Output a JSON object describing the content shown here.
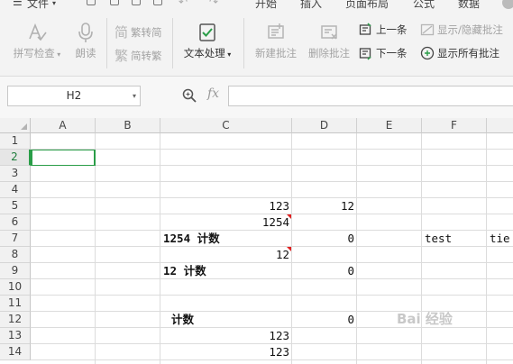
{
  "menubar": {
    "file_label": "文件",
    "tabs": [
      "开始",
      "插入",
      "页面布局",
      "公式",
      "数据"
    ]
  },
  "ribbon": {
    "spellcheck": "拼写检查",
    "read_aloud": "朗读",
    "trad_to_simp": "繁转简",
    "simp_to_trad": "简转繁",
    "text_processing": "文本处理",
    "new_comment": "新建批注",
    "delete_comment": "删除批注",
    "prev_comment": "上一条",
    "next_comment": "下一条",
    "toggle_comments": "显示/隐藏批注",
    "show_all_comments": "显示所有批注"
  },
  "formula_bar": {
    "name_box": "H2",
    "fx_label": "fx",
    "formula": ""
  },
  "grid": {
    "columns": [
      "A",
      "B",
      "C",
      "D",
      "E",
      "F"
    ],
    "rows": [
      "1",
      "2",
      "3",
      "4",
      "5",
      "6",
      "7",
      "8",
      "9",
      "10",
      "11",
      "12",
      "13",
      "14"
    ],
    "selected_row": "2",
    "cells": {
      "C5": "123",
      "D5": "12",
      "C6": "1254",
      "C7": "1254 计数",
      "D7": "0",
      "F7": "test",
      "G7": "tie",
      "C8": "12",
      "C9": "12 计数",
      "D9": "0",
      "C12": "计数",
      "D12": "0",
      "C13": "123",
      "C14": "123"
    }
  },
  "watermark": "Bai 经验"
}
